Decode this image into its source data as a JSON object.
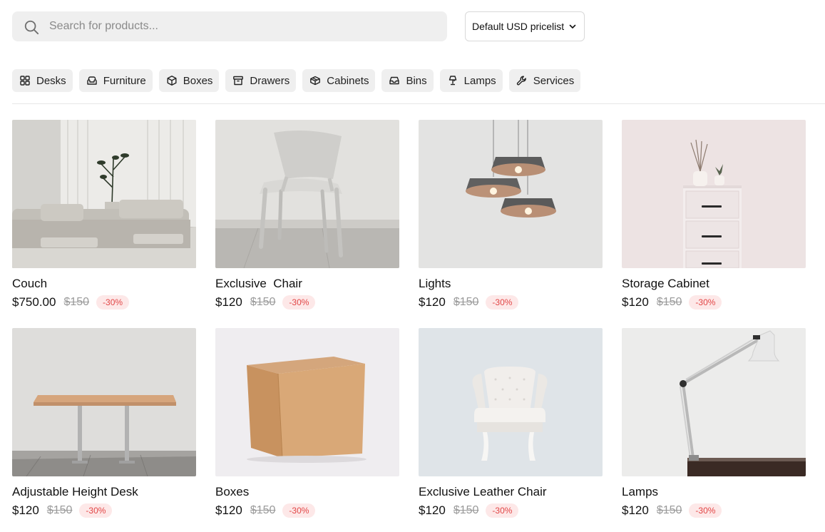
{
  "search": {
    "placeholder": "Search for products..."
  },
  "pricelist": {
    "selected": "Default USD pricelist"
  },
  "categories": [
    {
      "label": "Desks",
      "icon": "grid-icon"
    },
    {
      "label": "Furniture",
      "icon": "sofa-icon"
    },
    {
      "label": "Boxes",
      "icon": "box-icon"
    },
    {
      "label": "Drawers",
      "icon": "archive-icon"
    },
    {
      "label": "Cabinets",
      "icon": "cabinet-icon"
    },
    {
      "label": "Bins",
      "icon": "inbox-icon"
    },
    {
      "label": "Lamps",
      "icon": "lamp-icon"
    },
    {
      "label": "Services",
      "icon": "wrench-icon"
    }
  ],
  "products": [
    {
      "name": "Couch",
      "price": "$750.00",
      "old_price": "$150",
      "discount": "-30%"
    },
    {
      "name": "Exclusive  Chair",
      "price": "$120",
      "old_price": "$150",
      "discount": "-30%"
    },
    {
      "name": "Lights",
      "price": "$120",
      "old_price": "$150",
      "discount": "-30%"
    },
    {
      "name": "Storage Cabinet",
      "price": "$120",
      "old_price": "$150",
      "discount": "-30%"
    },
    {
      "name": "Adjustable Height Desk",
      "price": "$120",
      "old_price": "$150",
      "discount": "-30%"
    },
    {
      "name": "Boxes",
      "price": "$120",
      "old_price": "$150",
      "discount": "-30%"
    },
    {
      "name": "Exclusive Leather Chair",
      "price": "$120",
      "old_price": "$150",
      "discount": "-30%"
    },
    {
      "name": "Lamps",
      "price": "$120",
      "old_price": "$150",
      "discount": "-30%"
    }
  ],
  "colors": {
    "badge_bg": "#fde8e8",
    "badge_text": "#e24646",
    "chip_bg": "#efefef"
  }
}
